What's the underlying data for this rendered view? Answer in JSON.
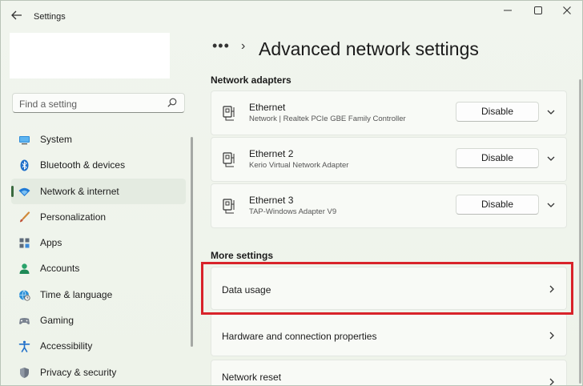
{
  "window": {
    "title": "Settings",
    "controls": [
      "minimize-icon",
      "maximize-icon",
      "close-icon"
    ]
  },
  "search": {
    "placeholder": "Find a setting"
  },
  "sidebar": {
    "items": [
      {
        "label": "System",
        "icon": "system-icon",
        "active": false
      },
      {
        "label": "Bluetooth & devices",
        "icon": "bluetooth-icon",
        "active": false
      },
      {
        "label": "Network & internet",
        "icon": "network-wifi-icon",
        "active": true
      },
      {
        "label": "Personalization",
        "icon": "brush-icon",
        "active": false
      },
      {
        "label": "Apps",
        "icon": "apps-icon",
        "active": false
      },
      {
        "label": "Accounts",
        "icon": "accounts-icon",
        "active": false
      },
      {
        "label": "Time & language",
        "icon": "globe-clock-icon",
        "active": false
      },
      {
        "label": "Gaming",
        "icon": "gamepad-icon",
        "active": false
      },
      {
        "label": "Accessibility",
        "icon": "accessibility-icon",
        "active": false
      },
      {
        "label": "Privacy & security",
        "icon": "shield-icon",
        "active": false
      }
    ]
  },
  "breadcrumb": {
    "more": "•••",
    "separator": "›",
    "title": "Advanced network settings"
  },
  "adapters": {
    "section_title": "Network adapters",
    "items": [
      {
        "name": "Ethernet",
        "description": "Network | Realtek PCIe GBE Family Controller",
        "button": "Disable"
      },
      {
        "name": "Ethernet 2",
        "description": "Kerio Virtual Network Adapter",
        "button": "Disable"
      },
      {
        "name": "Ethernet 3",
        "description": "TAP-Windows Adapter V9",
        "button": "Disable"
      }
    ]
  },
  "more_settings": {
    "section_title": "More settings",
    "items": [
      {
        "label": "Data usage",
        "highlighted": true
      },
      {
        "label": "Hardware and connection properties",
        "highlighted": false
      },
      {
        "label": "Network reset",
        "highlighted": false
      }
    ]
  },
  "colors": {
    "highlight": "#d8232a",
    "accent": "#3a6a3f",
    "wifi_blue": "#1f7ad6"
  }
}
